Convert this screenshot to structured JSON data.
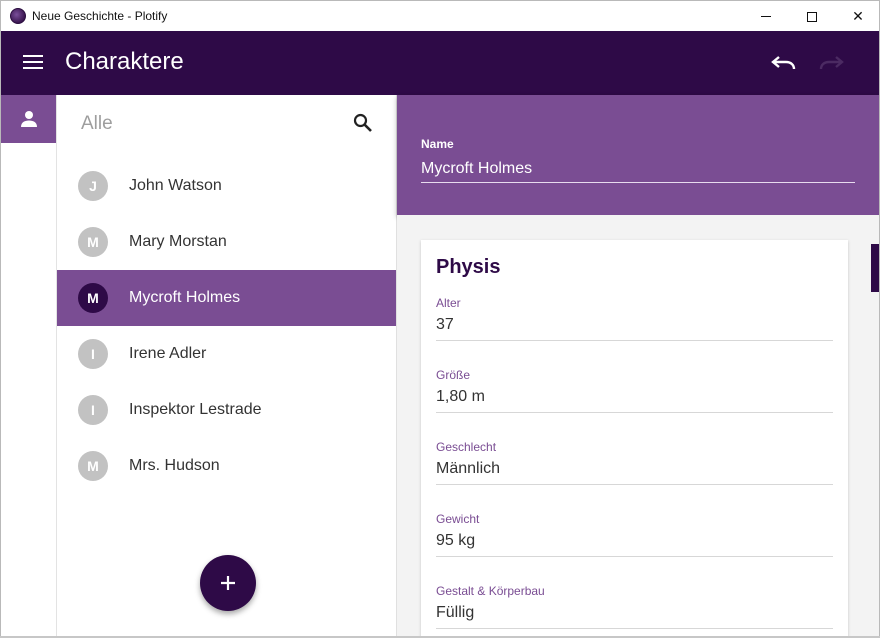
{
  "window": {
    "title": "Neue Geschichte - Plotify",
    "minimize_symbol": "",
    "close_symbol": "✕"
  },
  "appbar": {
    "title": "Charaktere",
    "background": "#2e0a47",
    "menu_icon": "menu-icon",
    "undo_icon": "undo-icon",
    "redo_icon": "redo-icon"
  },
  "rail": {
    "items": [
      {
        "icon": "person-icon",
        "selected": true
      }
    ]
  },
  "list": {
    "filter_label": "Alle",
    "search_icon": "search-icon",
    "items": [
      {
        "initial": "J",
        "name": "John Watson",
        "selected": false
      },
      {
        "initial": "M",
        "name": "Mary Morstan",
        "selected": false
      },
      {
        "initial": "M",
        "name": "Mycroft Holmes",
        "selected": true
      },
      {
        "initial": "I",
        "name": "Irene Adler",
        "selected": false
      },
      {
        "initial": "I",
        "name": "Inspektor Lestrade",
        "selected": false
      },
      {
        "initial": "M",
        "name": "Mrs. Hudson",
        "selected": false
      }
    ],
    "fab_icon": "add-icon"
  },
  "detail": {
    "name_label": "Name",
    "name_value": "Mycroft Holmes",
    "card": {
      "title": "Physis",
      "fields": [
        {
          "label": "Alter",
          "value": "37"
        },
        {
          "label": "Größe",
          "value": "1,80 m"
        },
        {
          "label": "Geschlecht",
          "value": "Männlich"
        },
        {
          "label": "Gewicht",
          "value": "95 kg"
        },
        {
          "label": "Gestalt & Körperbau",
          "value": "Füllig"
        }
      ]
    }
  },
  "colors": {
    "primary_dark": "#2e0a47",
    "primary": "#7a4d93",
    "avatar_grey": "#c2c2c2"
  }
}
